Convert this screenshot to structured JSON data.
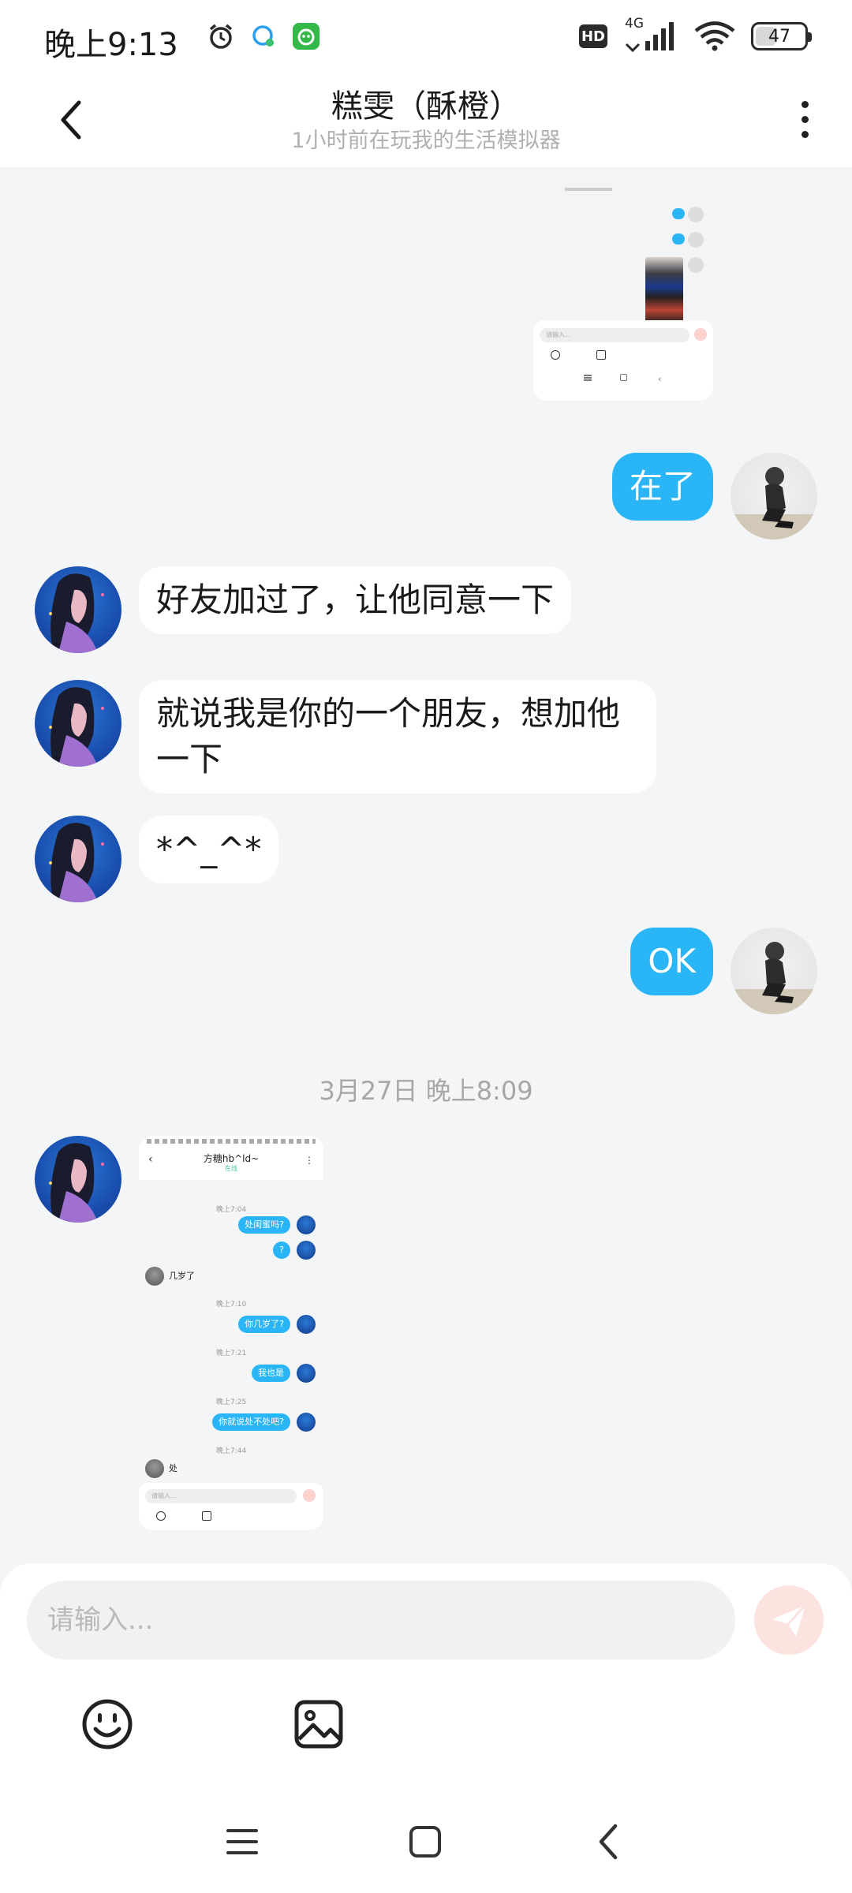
{
  "status_bar": {
    "time": "晚上9:13",
    "hd": "HD",
    "network": "4G",
    "battery": "47",
    "battery_level": 0.47
  },
  "header": {
    "title": "糕雯（酥橙）",
    "subtitle": "1小时前在玩我的生活模拟器"
  },
  "messages": [
    {
      "side": "self",
      "text": "在了"
    },
    {
      "side": "other",
      "text": "好友加过了，让他同意一下"
    },
    {
      "side": "other",
      "text": "就说我是你的一个朋友，想加他一下"
    },
    {
      "side": "other",
      "text": "*^_^*"
    },
    {
      "side": "self",
      "text": "OK"
    }
  ],
  "timestamp": "3月27日 晚上8:09",
  "shared_screenshot": {
    "contact": "方糖hb^ld~",
    "status": "在线",
    "time_1": "晚上7:04",
    "msg_1": "处闺蜜吗?",
    "msg_2": "?",
    "reply_1": "几岁了",
    "time_2": "晚上7:10",
    "msg_3": "你几岁了?",
    "time_3": "晚上7:21",
    "msg_4": "我也是",
    "time_4": "晚上7:25",
    "msg_5": "你就说处不处吧?",
    "time_5": "晚上7:44",
    "reply_2": "处",
    "input_placeholder": "请输入..."
  },
  "top_screenshot": {
    "input_placeholder": "请输入..."
  },
  "input": {
    "placeholder": "请输入..."
  },
  "icons": {
    "back": "chevron-left-icon",
    "more": "more-vertical-icon",
    "send": "send-icon",
    "emoji": "emoji-icon",
    "image": "image-icon"
  },
  "colors": {
    "self_bubble": "#29b5f6",
    "other_bubble": "#ffffff",
    "background": "#f4f5f7",
    "send_button": "#fde3e0"
  }
}
